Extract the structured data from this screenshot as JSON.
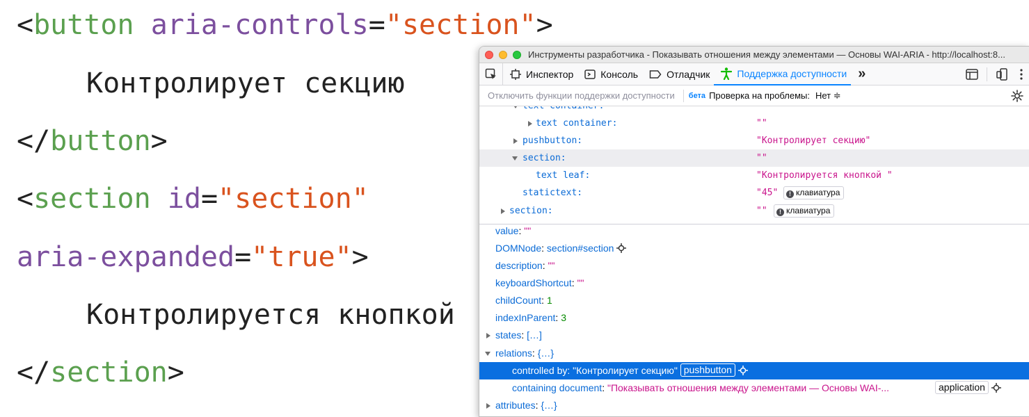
{
  "slide": {
    "line1": {
      "open": "<",
      "tag": "button",
      "attr": "aria-controls",
      "eq": "=",
      "value": "\"section\"",
      "close": ">"
    },
    "line2": "Контролирует секцию",
    "line3": {
      "open": "</",
      "tag": "button",
      "close": ">"
    },
    "line4": {
      "open": "<",
      "tag": "section",
      "attr": "id",
      "eq": "=",
      "value": "\"section\""
    },
    "line5": {
      "attr": "aria-expanded",
      "eq": "=",
      "value": "\"true\"",
      "close": ">"
    },
    "line6": "Контролируется кнопкой",
    "line7": {
      "open": "</",
      "tag": "section",
      "close": ">"
    }
  },
  "window": {
    "title": "Инструменты разработчика - Показывать отношения между элементами — Основы WAI-ARIA - http://localhost:8..."
  },
  "toolbar": {
    "tabs": [
      {
        "label": "Инспектор",
        "icon": "inspector-icon"
      },
      {
        "label": "Консоль",
        "icon": "console-icon"
      },
      {
        "label": "Отладчик",
        "icon": "debugger-icon"
      },
      {
        "label": "Поддержка доступности",
        "icon": "accessibility-icon",
        "active": true
      }
    ],
    "more": "»"
  },
  "subbar": {
    "disable_label": "Отключить функции поддержки доступности",
    "beta": "бета",
    "check_label": "Проверка на проблемы:",
    "check_value": "Нет ≑"
  },
  "tree": {
    "rows": [
      {
        "role": "text container:",
        "name": ""
      },
      {
        "role": "text container:",
        "name": "\"\""
      },
      {
        "role": "pushbutton:",
        "name": "\"Контролирует секцию\""
      },
      {
        "role": "section:",
        "name": "\"\""
      },
      {
        "role": "text leaf:",
        "name": "\"Контролируется кнопкой \""
      },
      {
        "role": "statictext:",
        "name": "\"45\"",
        "badge": "клавиатура"
      },
      {
        "role": "section:",
        "name": "\"\"",
        "badge": "клавиатура"
      }
    ]
  },
  "props": {
    "value": {
      "key": "value",
      "val": "\"\""
    },
    "domnode": {
      "key": "DOMNode",
      "val": "section#section"
    },
    "description": {
      "key": "description",
      "val": "\"\""
    },
    "shortcut": {
      "key": "keyboardShortcut",
      "val": "\"\""
    },
    "childcount": {
      "key": "childCount",
      "val": "1"
    },
    "indexinparent": {
      "key": "indexInParent",
      "val": "3"
    },
    "states": {
      "key": "states",
      "val": "[…]"
    },
    "relations": {
      "key": "relations",
      "val": "{…}"
    },
    "controlled_by": {
      "key": "controlled by",
      "val": "\"Контролирует секцию\"",
      "badge": "pushbutton"
    },
    "containing_doc": {
      "key": "containing document",
      "val": "\"Показывать отношения между элементами — Основы WAI-...",
      "badge": "application"
    },
    "attributes": {
      "key": "attributes",
      "val": "{…}"
    },
    "colon": ": "
  },
  "colors": {
    "accent": "#0a84ff",
    "selected_row": "#0a6fe0",
    "tag_green": "#5ba04f",
    "attr_purple": "#7c4f9e",
    "string_orange": "#d9531e"
  }
}
